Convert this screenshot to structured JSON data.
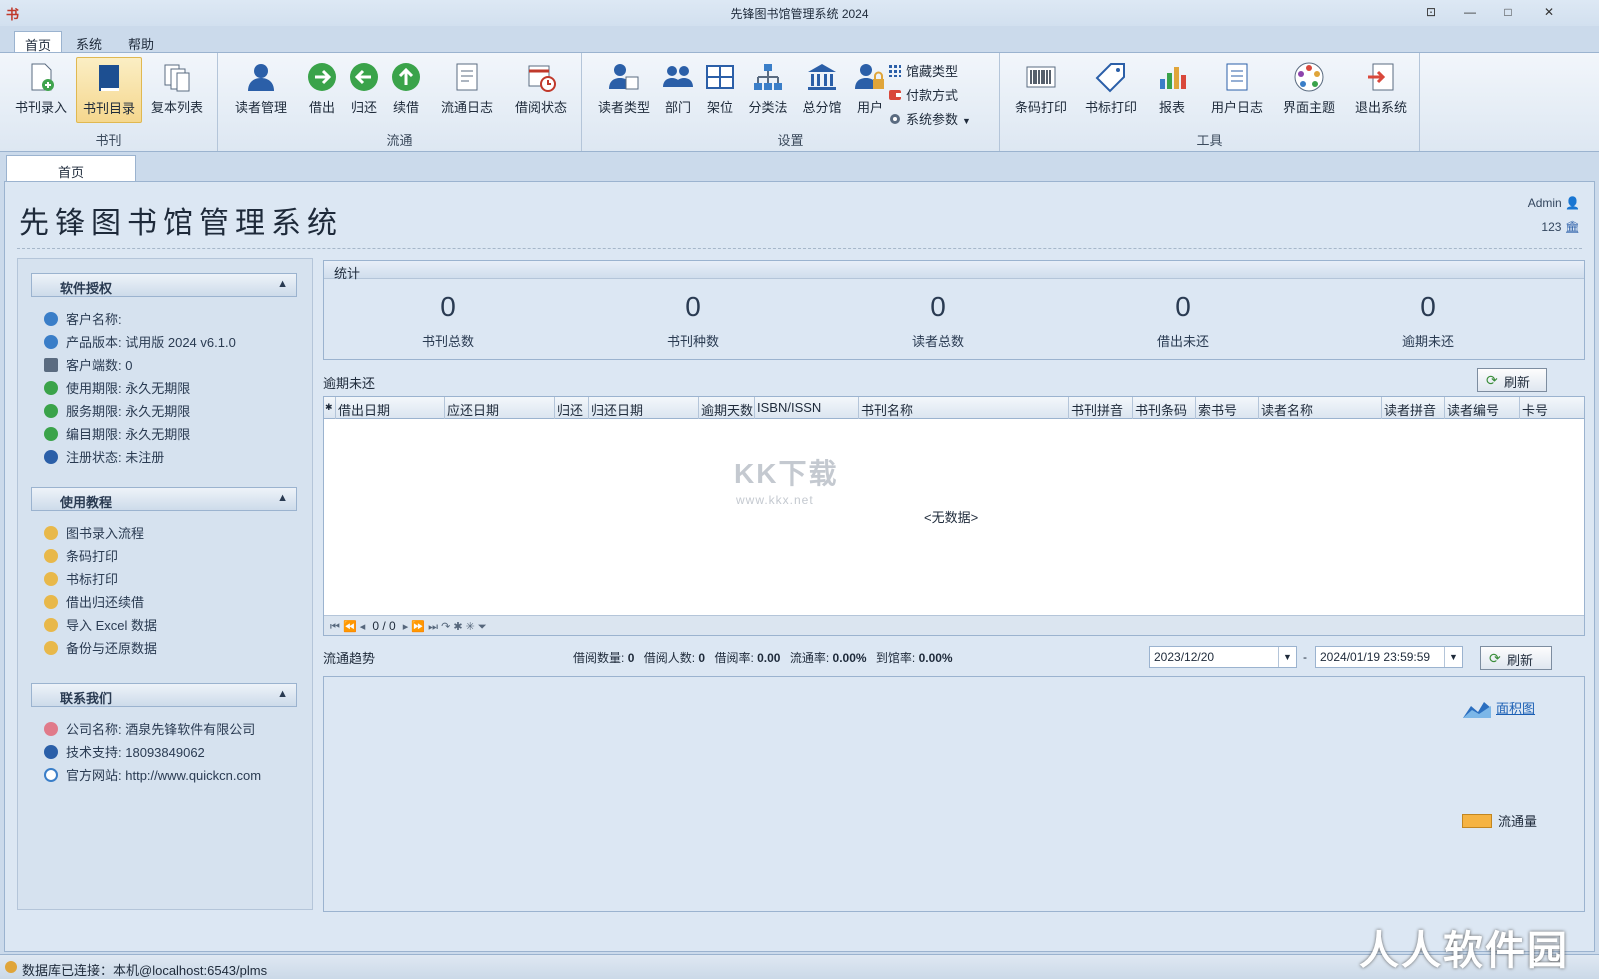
{
  "window": {
    "title": "先锋图书馆管理系统 2024"
  },
  "ribbon_tabs": [
    "首页",
    "系统",
    "帮助"
  ],
  "groups": {
    "books": {
      "label": "书刊",
      "buttons": [
        "书刊录入",
        "书刊目录",
        "复本列表"
      ]
    },
    "circulation": {
      "label": "流通",
      "buttons": [
        "读者管理",
        "借出",
        "归还",
        "续借",
        "流通日志",
        "借阅状态"
      ]
    },
    "settings": {
      "label": "设置",
      "buttons": [
        "读者类型",
        "部门",
        "架位",
        "分类法",
        "总分馆",
        "用户"
      ],
      "small_buttons": [
        "馆藏类型",
        "付款方式",
        "系统参数"
      ]
    },
    "tools": {
      "label": "工具",
      "buttons": [
        "条码打印",
        "书标打印",
        "报表",
        "用户日志",
        "界面主题",
        "退出系统"
      ]
    }
  },
  "doc_tab": "首页",
  "main_title": "先锋图书馆管理系统",
  "user": {
    "name": "Admin",
    "branch": "123"
  },
  "license": {
    "header": "软件授权",
    "items": [
      {
        "label": "客户名称:",
        "value": ""
      },
      {
        "label": "产品版本:",
        "value": "试用版 2024 v6.1.0"
      },
      {
        "label": "客户端数:",
        "value": "0"
      },
      {
        "label": "使用期限:",
        "value": "永久无期限"
      },
      {
        "label": "服务期限:",
        "value": "永久无期限"
      },
      {
        "label": "编目期限:",
        "value": "永久无期限"
      },
      {
        "label": "注册状态:",
        "value": "未注册"
      }
    ]
  },
  "tutorial": {
    "header": "使用教程",
    "items": [
      "图书录入流程",
      "条码打印",
      "书标打印",
      "借出归还续借",
      "导入 Excel 数据",
      "备份与还原数据"
    ]
  },
  "contact": {
    "header": "联系我们",
    "items": [
      {
        "label": "公司名称:",
        "value": "酒泉先锋软件有限公司"
      },
      {
        "label": "技术支持:",
        "value": "18093849062"
      },
      {
        "label": "官方网站:",
        "value": "http://www.quickcn.com"
      }
    ]
  },
  "stats": {
    "header": "统计",
    "items": [
      {
        "value": "0",
        "label": "书刊总数"
      },
      {
        "value": "0",
        "label": "书刊种数"
      },
      {
        "value": "0",
        "label": "读者总数"
      },
      {
        "value": "0",
        "label": "借出未还"
      },
      {
        "value": "0",
        "label": "逾期未还"
      }
    ]
  },
  "overdue": {
    "title": "逾期未还",
    "refresh": "刷新",
    "columns": [
      "借出日期",
      "应还日期",
      "归还",
      "归还日期",
      "逾期天数",
      "ISBN/ISSN",
      "书刊名称",
      "书刊拼音",
      "书刊条码",
      "索书号",
      "读者名称",
      "读者拼音",
      "读者编号",
      "卡号"
    ],
    "empty": "<无数据>",
    "pager": "0 / 0",
    "watermark": "KK下载",
    "watermark_url": "www.kkx.net"
  },
  "trend": {
    "title": "流通趋势",
    "stats": [
      {
        "label": "借阅数量:",
        "value": "0"
      },
      {
        "label": "借阅人数:",
        "value": "0"
      },
      {
        "label": "借阅率:",
        "value": "0.00"
      },
      {
        "label": "流通率:",
        "value": "0.00%"
      },
      {
        "label": "到馆率:",
        "value": "0.00%"
      }
    ],
    "date_from": "2023/12/20",
    "date_to": "2024/01/19 23:59:59",
    "separator": "-",
    "refresh": "刷新",
    "chart_type_label": "面积图",
    "legend": "流通量"
  },
  "status": "数据库已连接：本机@localhost:6543/plms",
  "brand": "人人软件园"
}
